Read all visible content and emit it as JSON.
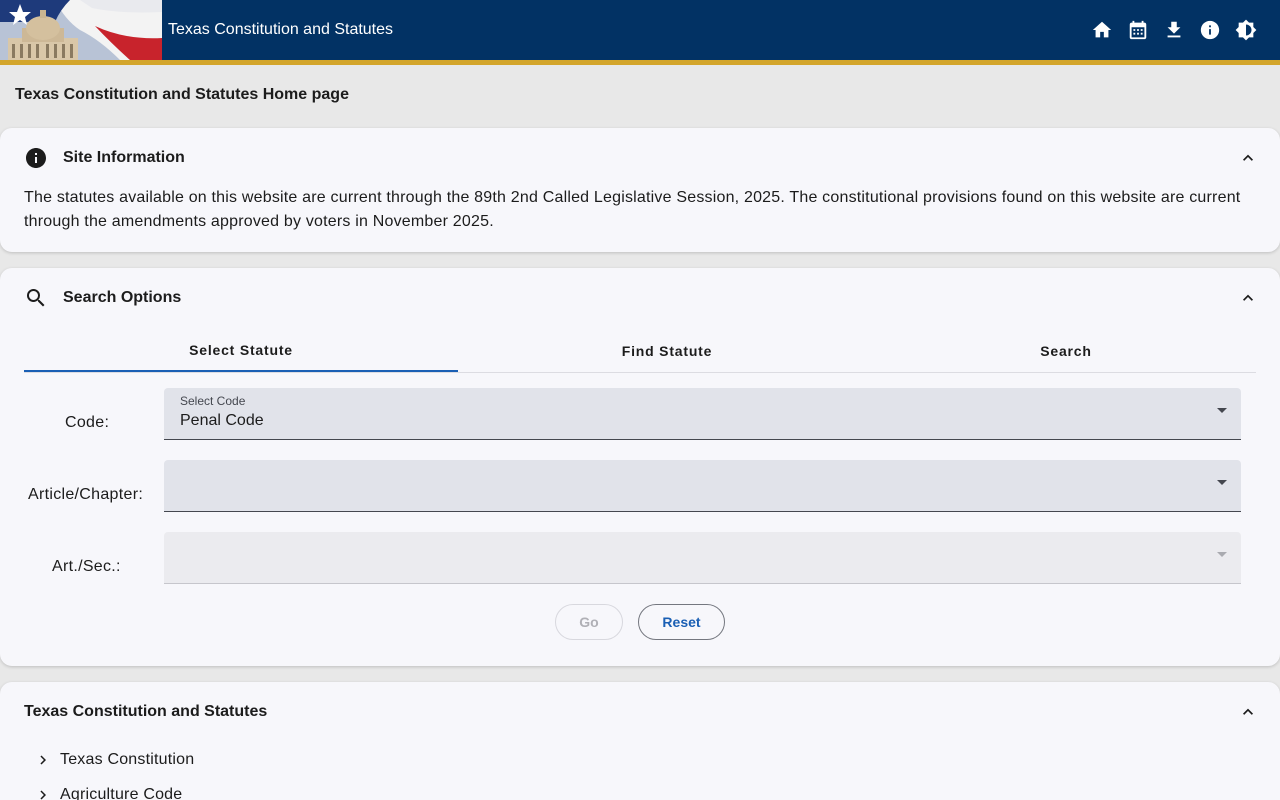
{
  "header": {
    "title": "Texas Constitution and Statutes",
    "actions": [
      {
        "name": "home-icon"
      },
      {
        "name": "calendar-icon"
      },
      {
        "name": "download-icon"
      },
      {
        "name": "info-icon"
      },
      {
        "name": "brightness-icon"
      }
    ],
    "colors": {
      "bar": "#023264",
      "accent": "#d3a52b"
    }
  },
  "page": {
    "title": "Texas Constitution and Statutes Home page"
  },
  "site_info": {
    "title": "Site Information",
    "text": "The statutes available on this website are current through the 89th 2nd Called Legislative Session, 2025. The constitutional provisions found on this website are current through the amendments approved by voters in November 2025."
  },
  "search": {
    "title": "Search Options",
    "tabs": [
      {
        "label": "Select Statute",
        "active": true
      },
      {
        "label": "Find Statute",
        "active": false
      },
      {
        "label": "Search",
        "active": false
      }
    ],
    "code": {
      "label": "Code:",
      "float_label": "Select Code",
      "value": "Penal Code"
    },
    "chapter": {
      "label": "Article/Chapter:",
      "value": ""
    },
    "section": {
      "label": "Art./Sec.:",
      "value": "",
      "disabled": true
    },
    "go_label": "Go",
    "reset_label": "Reset"
  },
  "tree": {
    "title": "Texas Constitution and Statutes",
    "items": [
      {
        "label": "Texas Constitution"
      },
      {
        "label": "Agriculture Code"
      }
    ]
  }
}
